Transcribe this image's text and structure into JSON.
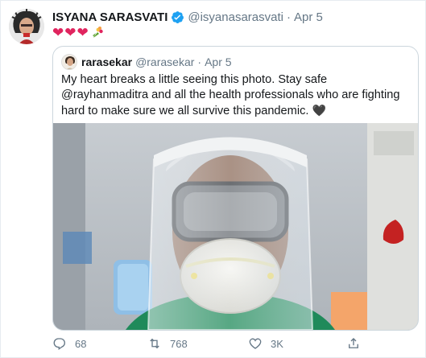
{
  "tweet": {
    "author_name": "ISYANA SARASVATI",
    "author_handle": "@isyanasarasvati",
    "separator": "·",
    "date": "Apr 5",
    "emoji_hearts": [
      "❤",
      "❤",
      "❤"
    ],
    "quoted": {
      "author_name": "rarasekar",
      "author_handle": "@rarasekar",
      "separator": "·",
      "date": "Apr 5",
      "text": "My heart breaks a little seeing this photo. Stay safe @rayhanmaditra and all the health professionals who are fighting hard to make sure we all survive this pandemic.",
      "text_emoji": "🖤"
    },
    "actions": {
      "reply_count": "68",
      "retweet_count": "768",
      "like_count": "3K"
    }
  },
  "colors": {
    "verified": "#1da1f2",
    "heart": "#e0245e",
    "muted": "#657786",
    "border": "#ccd6dd"
  },
  "icons": {
    "verified": "verified-badge-icon",
    "bouquet": "bouquet-icon",
    "reply": "reply-icon",
    "retweet": "retweet-icon",
    "like": "like-icon",
    "share": "share-icon"
  }
}
